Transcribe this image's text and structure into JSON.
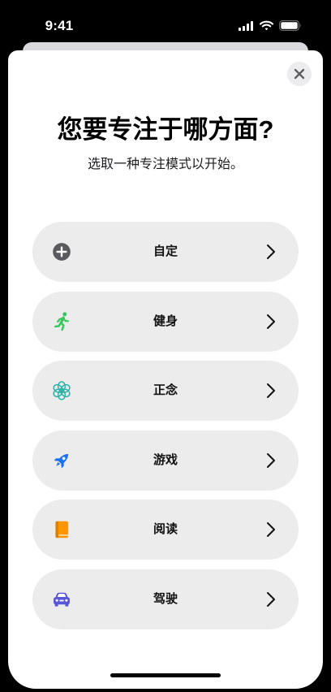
{
  "status_bar": {
    "time": "9:41",
    "icons": [
      "cellular-signal-icon",
      "wifi-icon",
      "battery-icon"
    ]
  },
  "sheet": {
    "close_button": {
      "icon": "xmark-icon"
    },
    "title": "您要专注于哪方面?",
    "subtitle": "选取一种专注模式以开始。",
    "options": [
      {
        "label": "自定",
        "icon": "plus-circle-icon",
        "color": "#5a5a5e"
      },
      {
        "label": "健身",
        "icon": "running-figure-icon",
        "color": "#34c759"
      },
      {
        "label": "正念",
        "icon": "flower-icon",
        "color": "#2fb3a8"
      },
      {
        "label": "游戏",
        "icon": "rocket-icon",
        "color": "#1b6ff3"
      },
      {
        "label": "阅读",
        "icon": "book-icon",
        "color": "#ff9500"
      },
      {
        "label": "驾驶",
        "icon": "car-icon",
        "color": "#5856d6"
      }
    ]
  },
  "colors": {
    "screen_background": "#000000",
    "sheet_background": "#ffffff",
    "option_background": "#ececed",
    "chevron": "#111111"
  }
}
